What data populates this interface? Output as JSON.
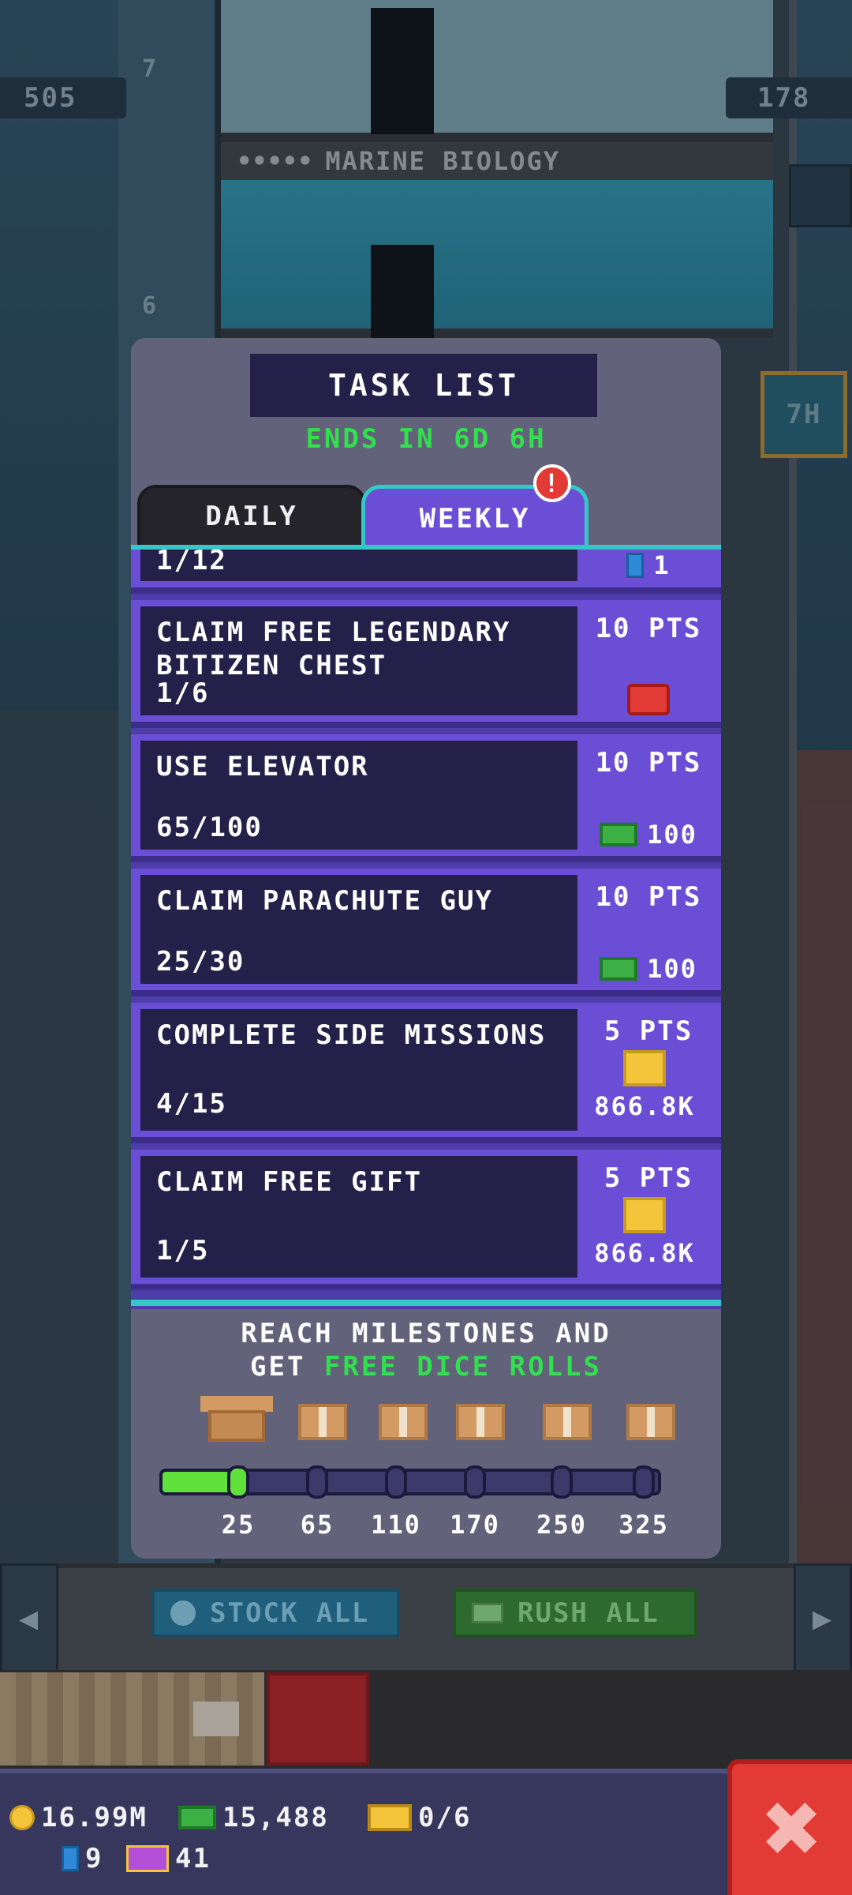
{
  "hud": {
    "population": "505",
    "floors": "178",
    "timer_badge": "7H",
    "floor_numbers": [
      "7",
      "6"
    ],
    "floor_sign": "MARINE BIOLOGY",
    "floor_sign_dots": "•••••"
  },
  "modal": {
    "title": "TASK LIST",
    "ends": "ENDS IN 6D 6H",
    "tabs": [
      {
        "label": "DAILY",
        "selected": false
      },
      {
        "label": "WEEKLY",
        "selected": true
      }
    ],
    "alert_glyph": "!"
  },
  "tasks": {
    "partial": {
      "progress": "1/12",
      "reward": "1",
      "reward_icon": "gem-icon"
    },
    "items": [
      {
        "name": "CLAIM FREE LEGENDARY BITIZEN CHEST",
        "progress": "1/6",
        "points": "10 PTS",
        "reward": "",
        "reward_icon": "video-chest-icon"
      },
      {
        "name": "USE ELEVATOR",
        "progress": "65/100",
        "points": "10 PTS",
        "reward": "100",
        "reward_icon": "bux-icon"
      },
      {
        "name": "CLAIM PARACHUTE GUY",
        "progress": "25/30",
        "points": "10 PTS",
        "reward": "100",
        "reward_icon": "bux-icon"
      },
      {
        "name": "COMPLETE SIDE MISSIONS",
        "progress": "4/15",
        "points": "5 PTS",
        "reward": "866.8K",
        "reward_icon": "coins-icon"
      },
      {
        "name": "CLAIM FREE GIFT",
        "progress": "1/5",
        "points": "5 PTS",
        "reward": "866.8K",
        "reward_icon": "coins-icon"
      }
    ]
  },
  "milestones": {
    "line1": "REACH MILESTONES AND",
    "line2_prefix": "GET ",
    "line2_highlight": "FREE DICE ROLLS",
    "thresholds": [
      "25",
      "65",
      "110",
      "170",
      "250",
      "325"
    ],
    "progress_fraction_of_first_segment": 1.0,
    "reached": 1
  },
  "actions": {
    "stock_all": "STOCK ALL",
    "rush_all": "RUSH ALL"
  },
  "resources": {
    "coins": "16.99M",
    "bux": "15,488",
    "vip": "0/6",
    "gems": "9",
    "dice": "41"
  },
  "close_glyph": "✖",
  "colors": {
    "accent_green": "#30e04c",
    "modal_purple": "#6a4fd6",
    "task_box": "#24204a",
    "teal": "#36c7c7",
    "close_red": "#e23a35"
  }
}
